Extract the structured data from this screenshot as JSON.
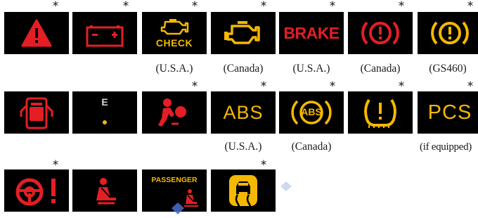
{
  "colors": {
    "red": "#e51e25",
    "amber": "#f5b800",
    "background": "#000000"
  },
  "row1": {
    "check_text": "CHECK",
    "brake_text": "BRAKE",
    "captions": {
      "check": "(U.S.A.)",
      "engine": "(Canada)",
      "brake": "(U.S.A.)",
      "brake_circle": "(Canada)",
      "brake_gs460": "(GS460)"
    }
  },
  "row2": {
    "e_text": "E",
    "abs_text": "ABS",
    "abs_circle_text": "ABS",
    "pcs_text": "PCS",
    "captions": {
      "abs": "(U.S.A.)",
      "abs_circle": "(Canada)",
      "pcs": "(if equipped)"
    }
  },
  "row3": {
    "passenger_text": "PASSENGER"
  },
  "star_symbol": "*",
  "icons": [
    "brake-warning-triangle-icon",
    "battery-icon",
    "check-engine-icon",
    "engine-icon",
    "brake-text-icon",
    "brake-circle-red-icon",
    "brake-circle-amber-icon",
    "open-door-icon",
    "fuel-low-icon",
    "srs-airbag-icon",
    "abs-text-icon",
    "abs-circle-icon",
    "tire-pressure-icon",
    "pcs-icon",
    "steering-warning-icon",
    "seatbelt-icon",
    "passenger-seatbelt-icon",
    "slip-indicator-icon"
  ]
}
